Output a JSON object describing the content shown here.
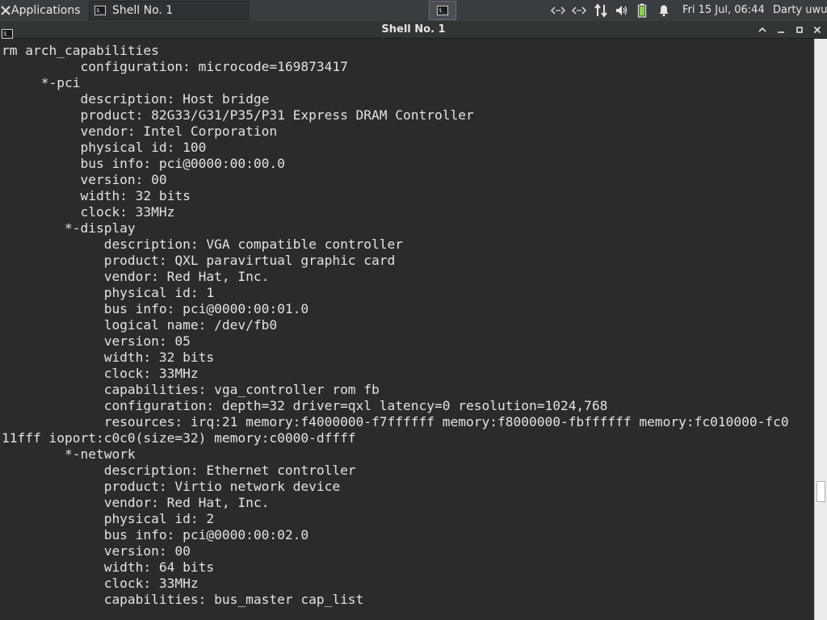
{
  "panel": {
    "applications_label": "Applications",
    "task_title": "Shell No. 1",
    "clock": "Fri 15 Jul, 06:44",
    "user": "Darty uwu",
    "tray_icons": [
      "network-icon",
      "network-icon",
      "transfer-icon",
      "volume-icon",
      "battery-icon",
      "notification-bell-icon"
    ]
  },
  "window": {
    "title": "Shell No. 1",
    "controls": [
      "maximize-up",
      "minimize",
      "restore",
      "close"
    ]
  },
  "terminal": {
    "lines": [
      "rm arch_capabilities",
      "          configuration: microcode=169873417",
      "     *-pci",
      "          description: Host bridge",
      "          product: 82G33/G31/P35/P31 Express DRAM Controller",
      "          vendor: Intel Corporation",
      "          physical id: 100",
      "          bus info: pci@0000:00:00.0",
      "          version: 00",
      "          width: 32 bits",
      "          clock: 33MHz",
      "        *-display",
      "             description: VGA compatible controller",
      "             product: QXL paravirtual graphic card",
      "             vendor: Red Hat, Inc.",
      "             physical id: 1",
      "             bus info: pci@0000:00:01.0",
      "             logical name: /dev/fb0",
      "             version: 05",
      "             width: 32 bits",
      "             clock: 33MHz",
      "             capabilities: vga_controller rom fb",
      "             configuration: depth=32 driver=qxl latency=0 resolution=1024,768",
      "             resources: irq:21 memory:f4000000-f7ffffff memory:f8000000-fbffffff memory:fc010000-fc0",
      "11fff ioport:c0c0(size=32) memory:c0000-dffff",
      "        *-network",
      "             description: Ethernet controller",
      "             product: Virtio network device",
      "             vendor: Red Hat, Inc.",
      "             physical id: 2",
      "             bus info: pci@0000:00:02.0",
      "             version: 00",
      "             width: 64 bits",
      "             clock: 33MHz",
      "             capabilities: bus_master cap_list"
    ]
  },
  "colors": {
    "panel_bg": "#3a3d40",
    "terminal_bg": "#2b2b2b",
    "terminal_fg": "#e3e3e3",
    "battery": "#8bd04c"
  }
}
